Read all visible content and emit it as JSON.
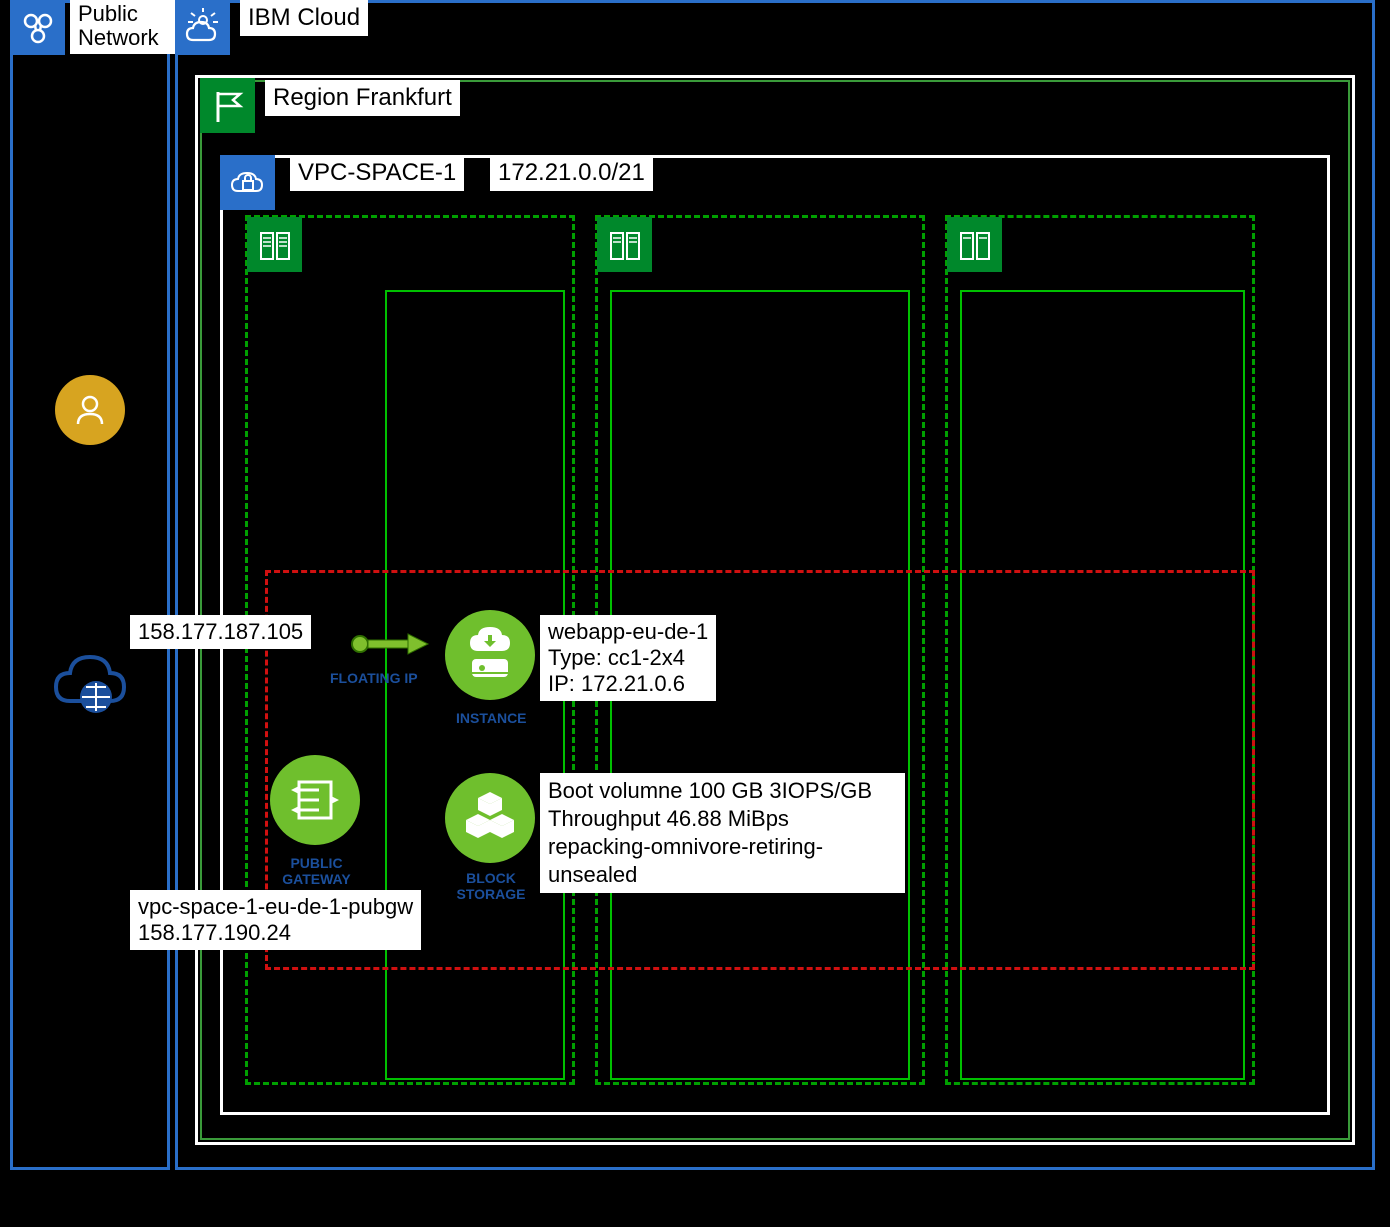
{
  "public_network": {
    "label": "Public Network"
  },
  "ibm_cloud": {
    "label": "IBM Cloud"
  },
  "region": {
    "label": "Region Frankfurt"
  },
  "vpc": {
    "name": "VPC-SPACE-1",
    "cidr": "172.21.0.0/21"
  },
  "floating_ip": {
    "address": "158.177.187.105",
    "caption": "FLOATING IP"
  },
  "instance": {
    "name": "webapp-eu-de-1",
    "type_line": "Type: cc1-2x4",
    "ip_line": "IP: 172.21.0.6",
    "caption": "INSTANCE"
  },
  "public_gateway": {
    "name": "vpc-space-1-eu-de-1-pubgw",
    "ip": "158.177.190.24",
    "caption": "PUBLIC GATEWAY"
  },
  "block_storage": {
    "line1": "Boot volumne 100 GB 3IOPS/GB",
    "line2": "Throughput 46.88 MiBps",
    "line3": "repacking-omnivore-retiring-unsealed",
    "caption": "BLOCK STORAGE"
  }
}
